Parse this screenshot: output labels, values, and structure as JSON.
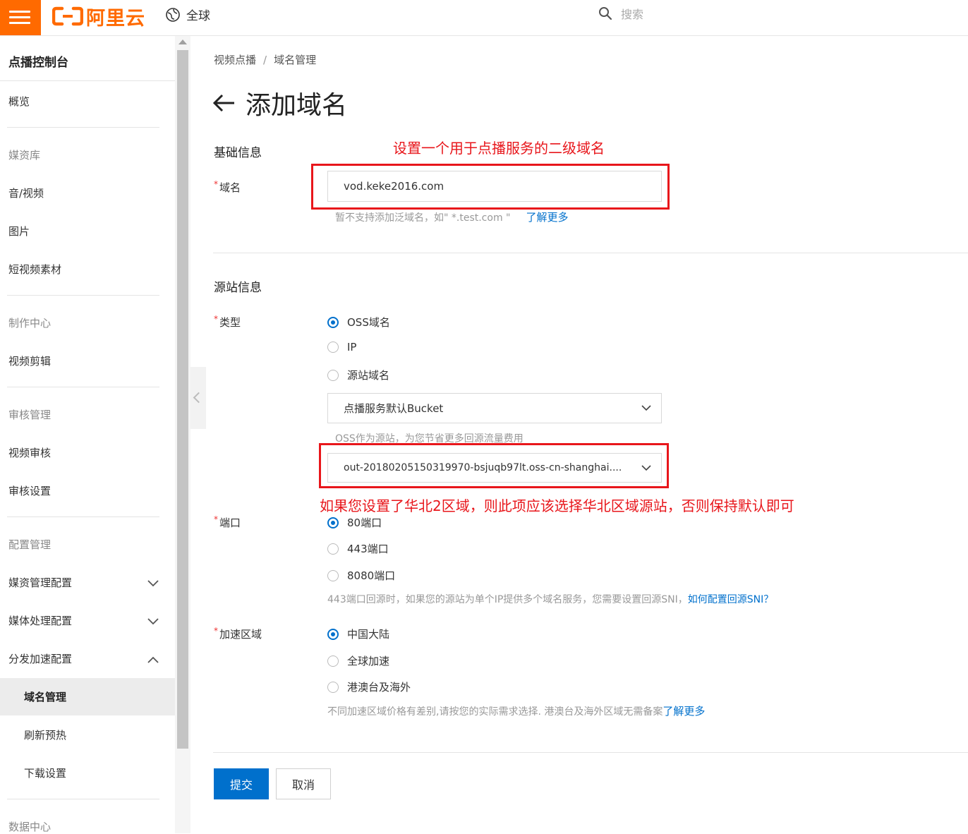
{
  "topbar": {
    "logo_text": "阿里云",
    "region": "全球",
    "search_placeholder": "搜索"
  },
  "sidebar": {
    "title": "点播控制台",
    "items": [
      {
        "label": "概览"
      },
      {
        "label": "媒资库"
      },
      {
        "label": "音/视频"
      },
      {
        "label": "图片"
      },
      {
        "label": "短视频素材"
      },
      {
        "label": "制作中心"
      },
      {
        "label": "视频剪辑"
      },
      {
        "label": "审核管理"
      },
      {
        "label": "视频审核"
      },
      {
        "label": "审核设置"
      },
      {
        "label": "配置管理"
      },
      {
        "label": "媒资管理配置"
      },
      {
        "label": "媒体处理配置"
      },
      {
        "label": "分发加速配置"
      },
      {
        "label": "域名管理"
      },
      {
        "label": "刷新预热"
      },
      {
        "label": "下载设置"
      },
      {
        "label": "数据中心"
      }
    ]
  },
  "breadcrumb": {
    "parent": "视频点播",
    "separator": "/",
    "current": "域名管理"
  },
  "page_title": "添加域名",
  "basic": {
    "section": "基础信息",
    "annotation": "设置一个用于点播服务的二级域名",
    "domain_label": "域名",
    "domain_value": "vod.keke2016.com",
    "domain_hint": "暂不支持添加泛域名，如\" *.test.com \"",
    "domain_hint_link": "了解更多"
  },
  "origin": {
    "section": "源站信息",
    "type_label": "类型",
    "type_options": [
      "OSS域名",
      "IP",
      "源站域名"
    ],
    "bucket_select": "点播服务默认Bucket",
    "oss_hint": "OSS作为源站，为您节省更多回源流量费用",
    "bucket_domain_select": "out-20180205150319970-bsjuqb97lt.oss-cn-shanghai....",
    "annotation": "如果您设置了华北2区域，则此项应该选择华北区域源站，否则保持默认即可",
    "port_label": "端口",
    "port_options": [
      "80端口",
      "443端口",
      "8080端口"
    ],
    "port_hint": "443端口回源时，如果您的源站为单个IP提供多个域名服务，您需要设置回源SNI，",
    "port_hint_link": "如何配置回源SNI？",
    "region_label": "加速区域",
    "region_options": [
      "中国大陆",
      "全球加速",
      "港澳台及海外"
    ],
    "region_hint": "不同加速区域价格有差别,请按您的实际需求选择. 港澳台及海外区域无需备案",
    "region_hint_link": "了解更多"
  },
  "actions": {
    "submit": "提交",
    "cancel": "取消"
  },
  "colors": {
    "brand": "#ff6a00",
    "primary": "#0070cc",
    "annotation": "#e8161b"
  }
}
